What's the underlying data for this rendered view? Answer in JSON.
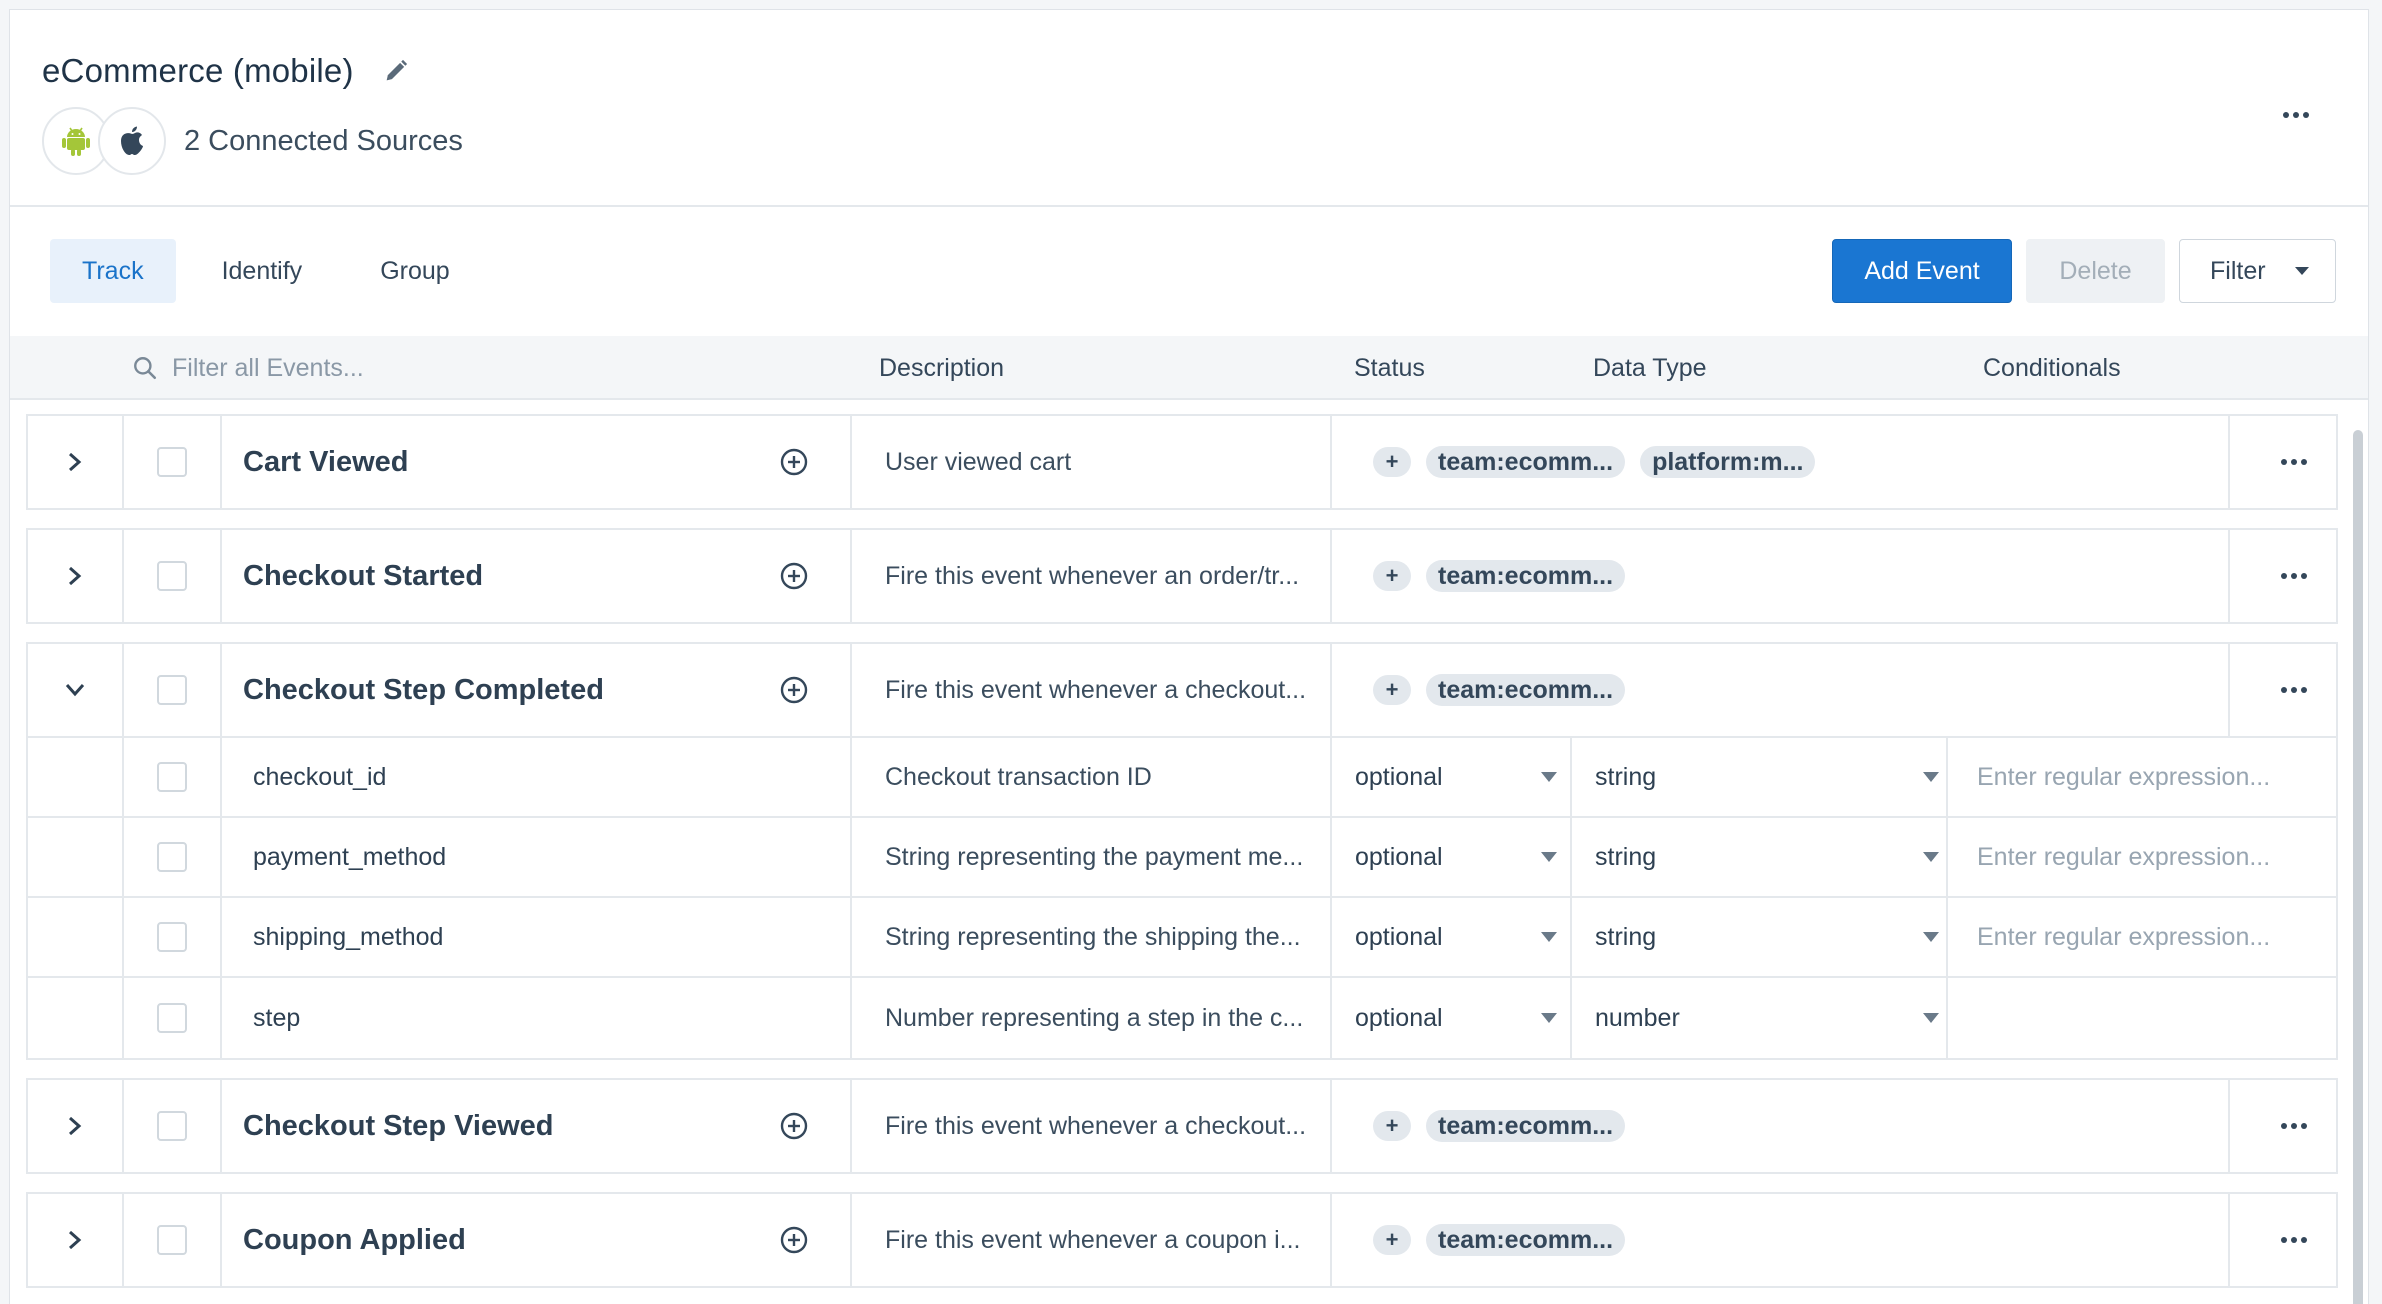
{
  "header": {
    "title": "eCommerce (mobile)",
    "connected_sources": "2 Connected Sources",
    "sources": [
      "android-icon",
      "apple-icon"
    ]
  },
  "tabs": [
    {
      "label": "Track",
      "active": true
    },
    {
      "label": "Identify",
      "active": false
    },
    {
      "label": "Group",
      "active": false
    }
  ],
  "actions": {
    "add_event": "Add Event",
    "delete": "Delete",
    "filter": "Filter"
  },
  "table": {
    "search_placeholder": "Filter all Events...",
    "columns": {
      "description": "Description",
      "status": "Status",
      "data_type": "Data Type",
      "conditionals": "Conditionals"
    }
  },
  "events": [
    {
      "name": "Cart Viewed",
      "description": "User viewed cart",
      "tags": [
        "team:ecomm...",
        "platform:m..."
      ],
      "expanded": false
    },
    {
      "name": "Checkout Started",
      "description": "Fire this event whenever an order/tr...",
      "tags": [
        "team:ecomm..."
      ],
      "expanded": false
    },
    {
      "name": "Checkout Step Completed",
      "description": "Fire this event whenever a checkout...",
      "tags": [
        "team:ecomm..."
      ],
      "expanded": true,
      "properties": [
        {
          "name": "checkout_id",
          "description": "Checkout transaction ID",
          "status": "optional",
          "type": "string",
          "regex_placeholder": "Enter regular expression..."
        },
        {
          "name": "payment_method",
          "description": "String representing the payment me...",
          "status": "optional",
          "type": "string",
          "regex_placeholder": "Enter regular expression..."
        },
        {
          "name": "shipping_method",
          "description": "String representing the shipping the...",
          "status": "optional",
          "type": "string",
          "regex_placeholder": "Enter regular expression..."
        },
        {
          "name": "step",
          "description": "Number representing a step in the c...",
          "status": "optional",
          "type": "number",
          "regex_placeholder": ""
        }
      ]
    },
    {
      "name": "Checkout Step Viewed",
      "description": "Fire this event whenever a checkout...",
      "tags": [
        "team:ecomm..."
      ],
      "expanded": false
    },
    {
      "name": "Coupon Applied",
      "description": "Fire this event whenever a coupon i...",
      "tags": [
        "team:ecomm..."
      ],
      "expanded": false
    }
  ],
  "colors": {
    "accent": "#1a76d2",
    "android": "#a4c639",
    "active_tab_bg": "#e8f1fb"
  }
}
